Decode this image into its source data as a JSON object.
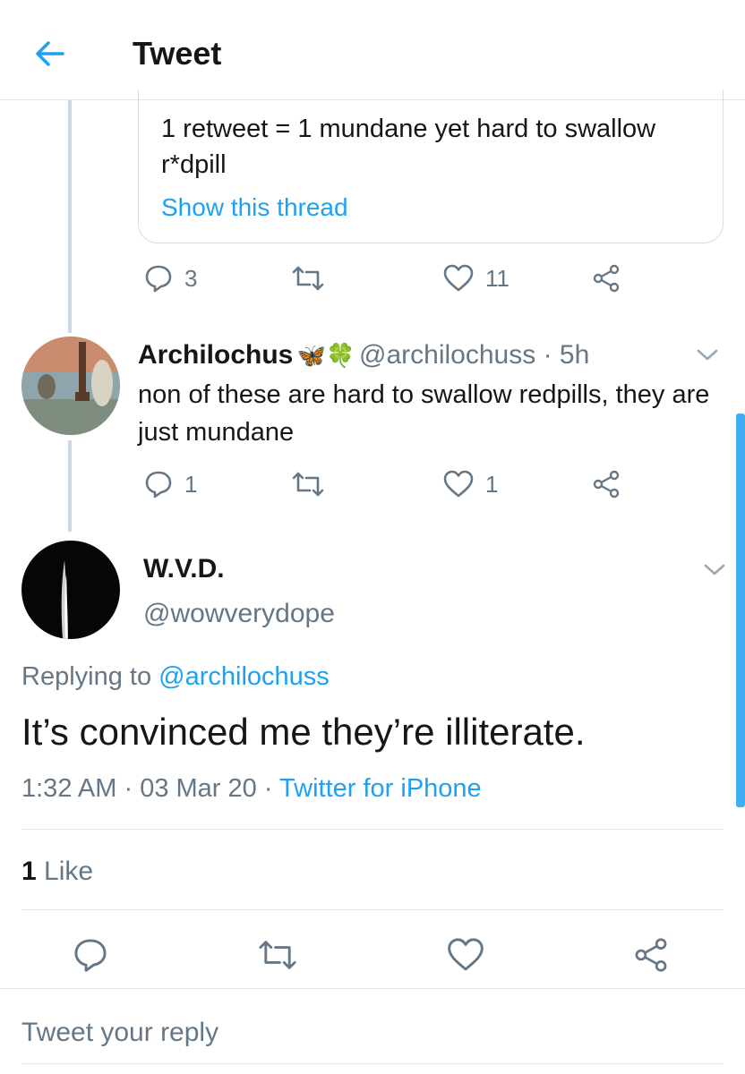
{
  "header": {
    "title": "Tweet"
  },
  "quoted": {
    "text": "1 retweet = 1 mundane yet hard to swallow r*dpill",
    "show_thread": "Show this thread",
    "replies": "3",
    "likes": "11"
  },
  "reply": {
    "name": "Archilochus",
    "emoji": "🦋🍀",
    "handle_time": "@archilochuss · 5h",
    "text": "non of these are hard to swallow redpills, they are just mundane",
    "replies": "1",
    "likes": "1"
  },
  "main": {
    "name": "W.V.D.",
    "handle": "@wowverydope",
    "replying_label": "Replying to",
    "replying_to": "@archilochuss",
    "text": "It’s convinced me they’re illiterate.",
    "time": "1:32 AM",
    "date": "03 Mar 20",
    "source": "Twitter for iPhone",
    "like_count": "1",
    "like_label": "Like"
  },
  "composer": {
    "placeholder": "Tweet your reply"
  },
  "colors": {
    "accent": "#1da1f2",
    "muted": "#657786",
    "text": "#14171a",
    "line": "#dfe5ea"
  }
}
